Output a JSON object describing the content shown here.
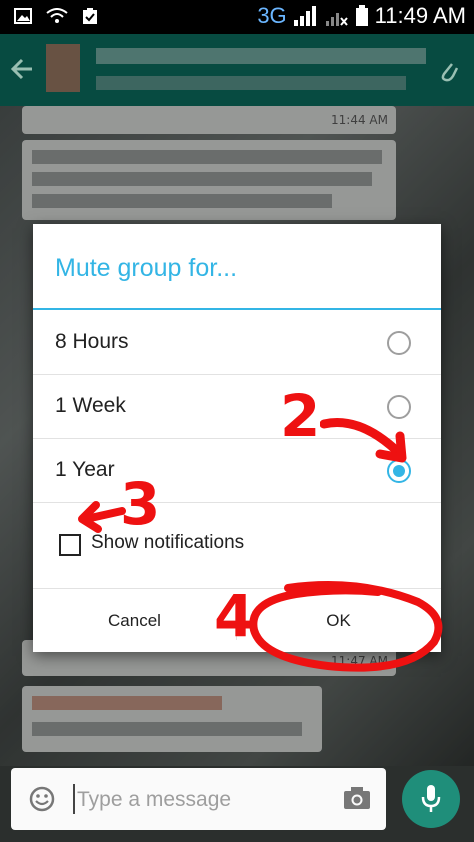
{
  "status_bar": {
    "network": "3G",
    "time": "11:49 AM"
  },
  "chat": {
    "timestamps": [
      "11:44 AM",
      "11:47 AM"
    ]
  },
  "dialog": {
    "title": "Mute group for...",
    "options": [
      {
        "label": "8 Hours",
        "selected": false
      },
      {
        "label": "1 Week",
        "selected": false
      },
      {
        "label": "1 Year",
        "selected": true
      }
    ],
    "show_notifications": {
      "label": "Show notifications",
      "checked": false
    },
    "cancel_label": "Cancel",
    "ok_label": "OK"
  },
  "composer": {
    "placeholder": "Type a message"
  },
  "annotations": {
    "step2": "2",
    "step3": "3",
    "step4": "4",
    "color": "#ee1111"
  },
  "colors": {
    "accent": "#33b5e5",
    "appbar": "#0a6457",
    "mic": "#1f8e7a"
  }
}
